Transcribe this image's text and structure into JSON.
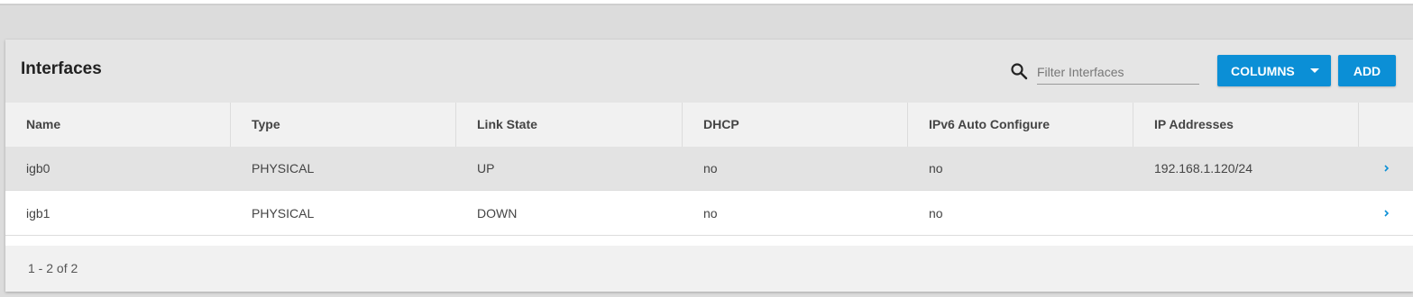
{
  "panel": {
    "title": "Interfaces",
    "search_placeholder": "Filter Interfaces",
    "columns_button": "COLUMNS",
    "add_button": "ADD"
  },
  "table": {
    "headers": [
      "Name",
      "Type",
      "Link State",
      "DHCP",
      "IPv6 Auto Configure",
      "IP Addresses"
    ],
    "rows": [
      [
        "igb0",
        "PHYSICAL",
        "UP",
        "no",
        "no",
        "192.168.1.120/24"
      ],
      [
        "igb1",
        "PHYSICAL",
        "DOWN",
        "no",
        "no",
        ""
      ]
    ],
    "selected_row": 0
  },
  "footer": {
    "page_info": "1 - 2 of 2"
  },
  "colors": {
    "accent": "#0b8fd6",
    "chevron": "#0b8fd6"
  },
  "icons": {
    "search": "search-icon",
    "columns_caret": "caret-down-icon",
    "row_expand": "chevron-right-icon"
  }
}
